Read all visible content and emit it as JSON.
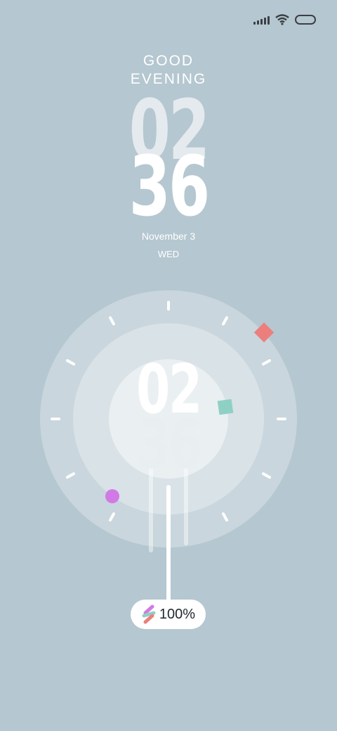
{
  "status_bar": {
    "icons": [
      "signal-icon",
      "wifi-icon",
      "battery-icon"
    ]
  },
  "clock": {
    "greeting_line1": "GOOD",
    "greeting_line2": "EVENING",
    "hour": "02",
    "minute": "36",
    "date": "November 3",
    "weekday": "WED"
  },
  "dial": {
    "hour": "02",
    "minute": "36",
    "marker_colors": {
      "diamond": "#ec7f7e",
      "square": "#8fd0c5",
      "dot": "#d17ae6"
    }
  },
  "battery": {
    "percent_label": "100%",
    "icon": "bolt-icon"
  },
  "colors": {
    "background": "#b5c7d0",
    "text": "#ffffff"
  }
}
